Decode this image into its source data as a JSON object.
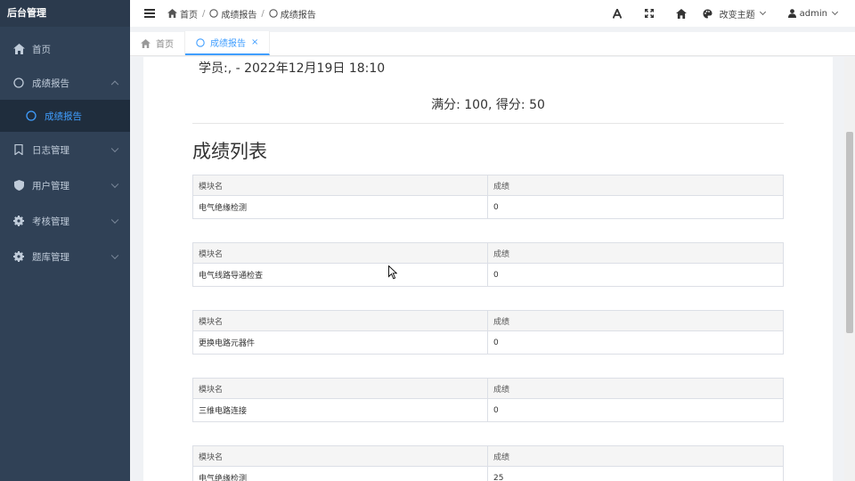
{
  "sidebar": {
    "title": "后台管理",
    "items": [
      {
        "label": "首页",
        "icon": "home-icon"
      },
      {
        "label": "成绩报告",
        "icon": "circle-icon"
      },
      {
        "label": "成绩报告",
        "icon": "circle-icon"
      },
      {
        "label": "日志管理",
        "icon": "bookmark-icon"
      },
      {
        "label": "用户管理",
        "icon": "shield-icon"
      },
      {
        "label": "考核管理",
        "icon": "gear-icon"
      },
      {
        "label": "题库管理",
        "icon": "gear-icon"
      }
    ]
  },
  "header": {
    "breadcrumb": [
      "首页",
      "成绩报告",
      "成绩报告"
    ],
    "theme_label": "改变主题",
    "user": "admin"
  },
  "tabs": [
    {
      "label": "首页"
    },
    {
      "label": "成绩报告",
      "close": "×"
    }
  ],
  "report": {
    "student_line": "学员:, - 2022年12月19日 18:10",
    "score_line": "满分: 100, 得分: 50",
    "list_title": "成绩列表",
    "col_module": "模块名",
    "col_score": "成绩",
    "rows": [
      {
        "module": "电气绝缘检测",
        "score": "0"
      },
      {
        "module": "电气线路导通检查",
        "score": "0"
      },
      {
        "module": "更换电路元器件",
        "score": "0"
      },
      {
        "module": "三维电路连接",
        "score": "0"
      },
      {
        "module": "电气绝缘检测",
        "score": "25"
      }
    ]
  },
  "colors": {
    "sidebar_bg": "#304156",
    "accent": "#409eff"
  }
}
